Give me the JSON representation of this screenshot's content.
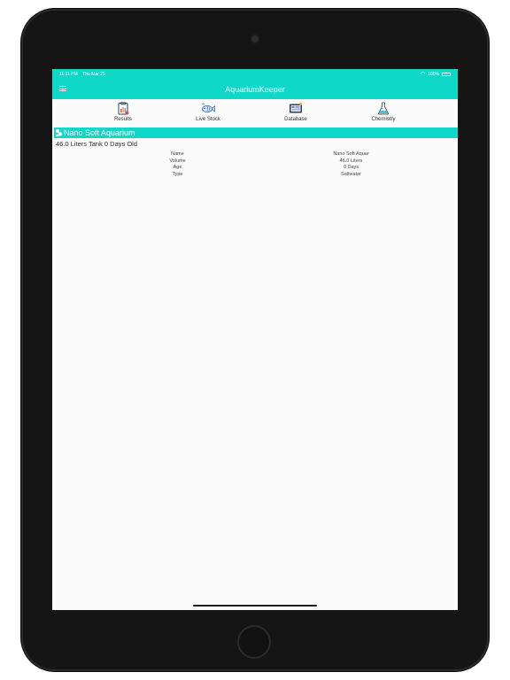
{
  "status_bar": {
    "time": "11:11 PM",
    "date": "Thu Mar 25",
    "battery": "100%"
  },
  "nav_bar": {
    "title": "AquariumKeeper"
  },
  "toolbar": {
    "items": [
      {
        "label": "Results",
        "icon": "clipboard-chart-icon"
      },
      {
        "label": "Live Stock",
        "icon": "fish-icon"
      },
      {
        "label": "Database",
        "icon": "database-screen-icon"
      },
      {
        "label": "Chemistry",
        "icon": "flask-icon"
      }
    ]
  },
  "tank": {
    "name": "Nano Soft Aquarium",
    "summary": "46.0 Liters Tank 0 Days Old",
    "details": [
      {
        "label": "Name",
        "value": "Nano Soft Aquar"
      },
      {
        "label": "Volume",
        "value": "46.0 Liters"
      },
      {
        "label": "Age",
        "value": "0 Days"
      },
      {
        "label": "Type",
        "value": "Saltwater"
      }
    ]
  },
  "colors": {
    "accent": "#0fd8c8",
    "background": "#fbfbfb",
    "device": "#141414"
  }
}
